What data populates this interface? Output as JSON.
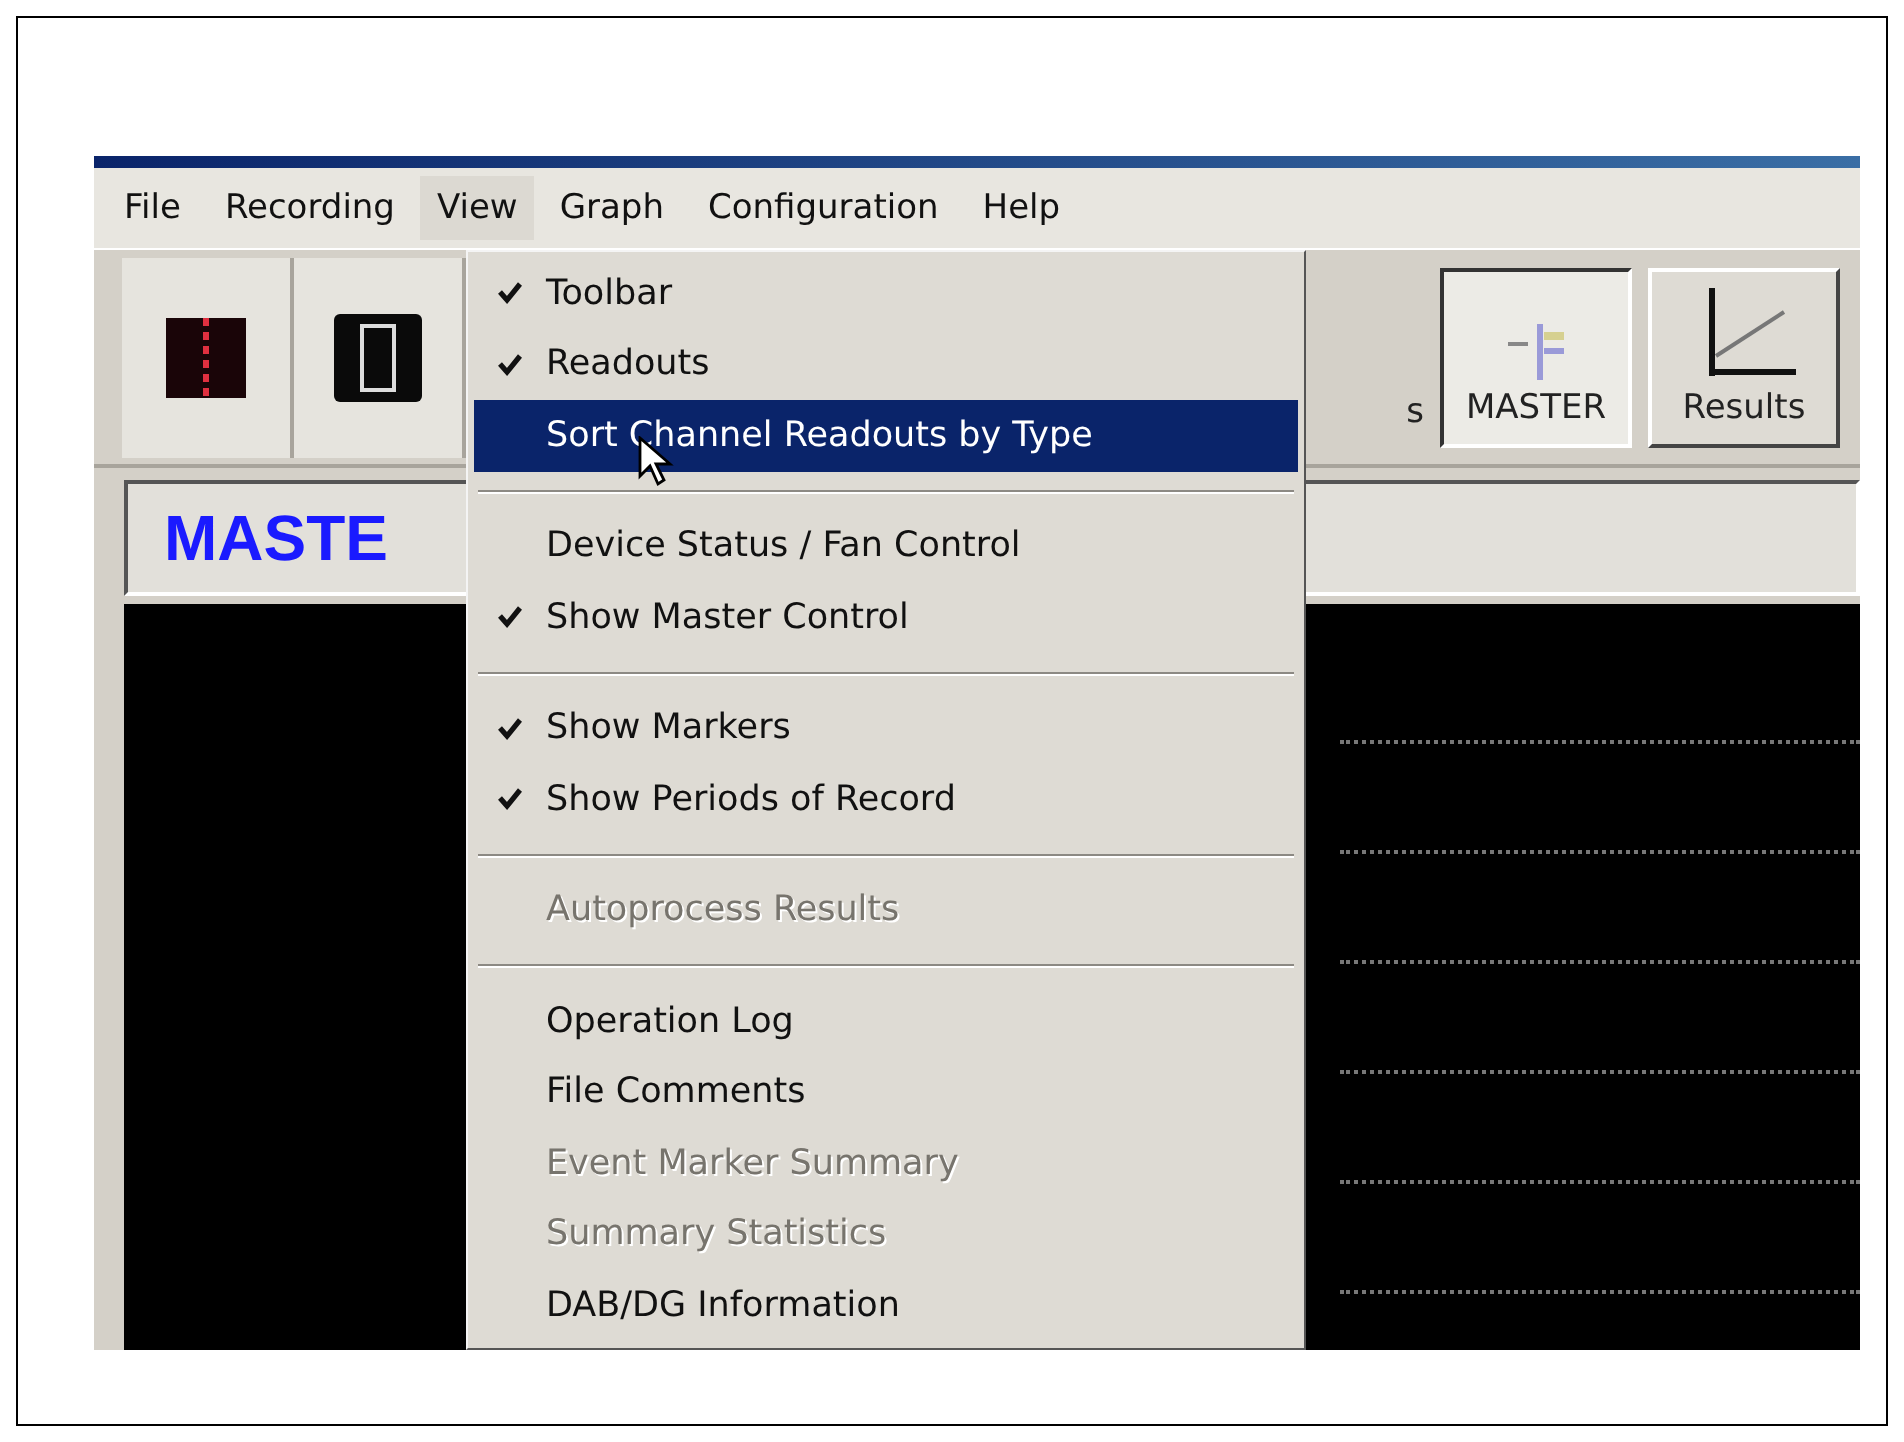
{
  "menu_bar": [
    {
      "label": "File",
      "selected": false
    },
    {
      "label": "Recording",
      "selected": false
    },
    {
      "label": "View",
      "selected": true
    },
    {
      "label": "Graph",
      "selected": false
    },
    {
      "label": "Configuration",
      "selected": false
    },
    {
      "label": "Help",
      "selected": false
    }
  ],
  "toolbar": [
    {
      "kind": "trace",
      "selected": false
    },
    {
      "kind": "frame",
      "selected": false
    },
    {
      "kind": "text",
      "label": "s",
      "selected": false
    },
    {
      "kind": "master",
      "label": "MASTER",
      "selected": true
    },
    {
      "kind": "results",
      "label": "Results",
      "selected": false
    }
  ],
  "master_panel": {
    "title": "MASTE"
  },
  "view_menu": [
    {
      "kind": "item",
      "label": "Toolbar",
      "checked": true,
      "disabled": false,
      "selected": false
    },
    {
      "kind": "item",
      "label": "Readouts",
      "checked": true,
      "disabled": false,
      "selected": false
    },
    {
      "kind": "item",
      "label": "Sort Channel Readouts by Type",
      "checked": false,
      "disabled": false,
      "selected": true
    },
    {
      "kind": "separator"
    },
    {
      "kind": "item",
      "label": "Device Status / Fan Control",
      "checked": false,
      "disabled": false,
      "selected": false
    },
    {
      "kind": "item",
      "label": "Show Master Control",
      "checked": true,
      "disabled": false,
      "selected": false
    },
    {
      "kind": "separator"
    },
    {
      "kind": "item",
      "label": "Show Markers",
      "checked": true,
      "disabled": false,
      "selected": false
    },
    {
      "kind": "item",
      "label": "Show Periods of Record",
      "checked": true,
      "disabled": false,
      "selected": false
    },
    {
      "kind": "separator"
    },
    {
      "kind": "item",
      "label": "Autoprocess Results",
      "checked": false,
      "disabled": true,
      "selected": false
    },
    {
      "kind": "separator"
    },
    {
      "kind": "item",
      "label": "Operation Log",
      "checked": false,
      "disabled": false,
      "selected": false
    },
    {
      "kind": "item",
      "label": "File Comments",
      "checked": false,
      "disabled": false,
      "selected": false
    },
    {
      "kind": "item",
      "label": "Event Marker Summary",
      "checked": false,
      "disabled": true,
      "selected": false
    },
    {
      "kind": "item",
      "label": "Summary Statistics",
      "checked": false,
      "disabled": true,
      "selected": false
    },
    {
      "kind": "item",
      "label": "DAB/DG Information",
      "checked": false,
      "disabled": false,
      "selected": false
    }
  ]
}
